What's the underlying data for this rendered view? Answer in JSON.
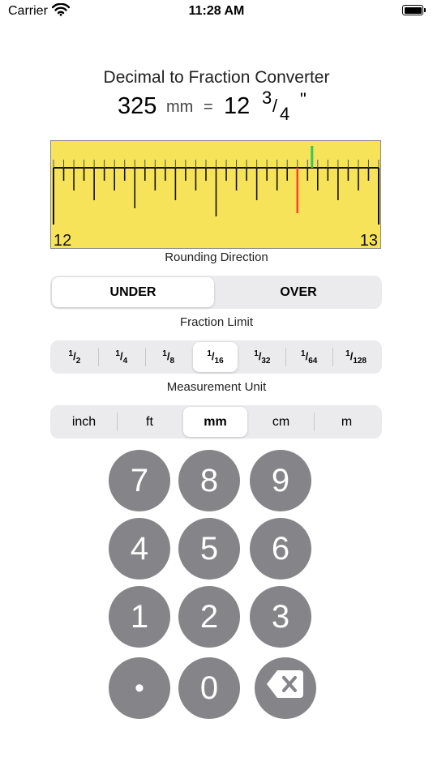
{
  "status_bar": {
    "carrier": "Carrier",
    "time": "11:28 AM"
  },
  "title": "Decimal to Fraction Converter",
  "result": {
    "decimal": "325",
    "unit": "mm",
    "equals": "=",
    "whole": "12",
    "numerator": "3",
    "slash": "/",
    "denominator": "4",
    "inch_symbol": "\""
  },
  "ruler": {
    "start_label": "12",
    "end_label": "13",
    "background": "#f6e35a",
    "value_fraction": 0.75,
    "exact_fraction": 0.795,
    "marker_color_rounded": "#ff3b30",
    "marker_color_exact": "#34c759"
  },
  "rounding": {
    "label": "Rounding Direction",
    "options": [
      "UNDER",
      "OVER"
    ],
    "selected": "UNDER"
  },
  "fraction_limit": {
    "label": "Fraction Limit",
    "options": [
      {
        "num": "1",
        "den": "2"
      },
      {
        "num": "1",
        "den": "4"
      },
      {
        "num": "1",
        "den": "8"
      },
      {
        "num": "1",
        "den": "16"
      },
      {
        "num": "1",
        "den": "32"
      },
      {
        "num": "1",
        "den": "64"
      },
      {
        "num": "1",
        "den": "128"
      }
    ],
    "selected_index": 3
  },
  "measurement_unit": {
    "label": "Measurement Unit",
    "options": [
      "inch",
      "ft",
      "mm",
      "cm",
      "m"
    ],
    "selected": "mm"
  },
  "keypad": {
    "key_color": "#858589",
    "keys": [
      "7",
      "8",
      "9",
      "4",
      "5",
      "6",
      "1",
      "2",
      "3",
      "•",
      "0"
    ],
    "delete_icon": "backspace-icon"
  }
}
